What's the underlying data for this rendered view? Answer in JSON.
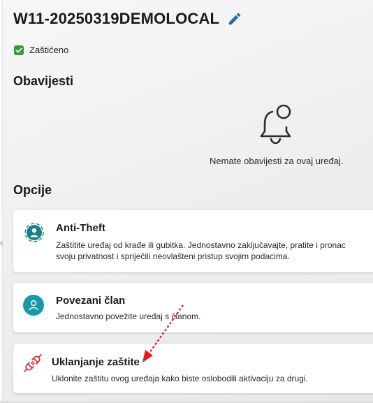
{
  "device": {
    "title": "W11-20250319DEMOLOCAL",
    "status": "Zaštićeno",
    "status_color": "#3a9a3a"
  },
  "notifications": {
    "heading": "Obavijesti",
    "empty_text": "Nemate obavijesti za ovaj uređaj.",
    "icon": "bell-icon"
  },
  "options": {
    "heading": "Opcije",
    "cards": [
      {
        "title": "Anti-Theft",
        "desc_line1": "Zaštitite uređaj od krađe ili gubitka. Jednostavno zaključavajte, pratite i pronac",
        "desc_line2": "svoju privatnost i spriječili neovlašteni pristup svojim podacima.",
        "icon": "anti-theft-icon",
        "icon_color": "#1a7f86"
      },
      {
        "title": "Povezani član",
        "desc_line1": "Jednostavno povežite uređaj s članom.",
        "icon": "person-icon",
        "icon_color": "#1a9aa6"
      },
      {
        "title": "Uklanjanje zaštite",
        "desc_line1": "Uklonite zaštitu ovog uređaja kako biste oslobodili aktivaciju za drugi.",
        "icon": "unplug-icon",
        "icon_color": "#d9322b"
      }
    ]
  },
  "colors": {
    "accent": "#1a7f86",
    "edit_icon": "#1f6fb2",
    "annotation_arrow": "#e01c1c"
  }
}
